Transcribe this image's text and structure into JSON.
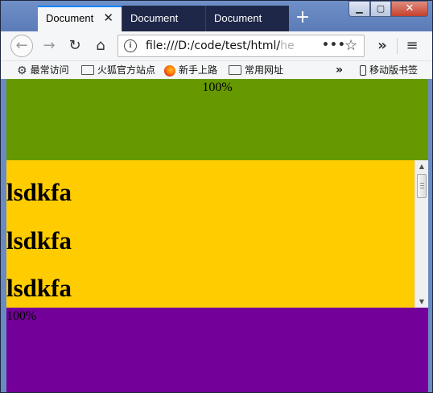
{
  "browser": {
    "tabs": [
      {
        "label": "Document",
        "active": true
      },
      {
        "label": "Document",
        "active": false
      },
      {
        "label": "Document",
        "active": false
      }
    ],
    "new_tab_label": "+",
    "close_tab_glyph": "✕",
    "window_controls": {
      "minimize_glyph": "▁",
      "maximize_glyph": "▢",
      "close_glyph": "✕"
    },
    "nav": {
      "back_glyph": "←",
      "forward_glyph": "→",
      "reload_glyph": "↻",
      "home_glyph": "⌂",
      "info_glyph": "i",
      "url_main": "file:///D:/code/test/html/",
      "url_faded": "he",
      "page_actions_glyph": "•••",
      "bookmark_star_glyph": "☆",
      "overflow_glyph": "»",
      "menu_glyph": "≡"
    },
    "bookmarks": [
      {
        "label": "最常访问",
        "icon": "gear-icon"
      },
      {
        "label": "火狐官方站点",
        "icon": "folder-icon"
      },
      {
        "label": "新手上路",
        "icon": "firefox-icon"
      },
      {
        "label": "常用网址",
        "icon": "folder-icon"
      }
    ],
    "bookmarks_overflow_glyph": "»",
    "mobile_bookmarks_label": "移动版书签"
  },
  "page": {
    "green_block": {
      "label": "100%",
      "color": "#669900"
    },
    "yellow_block": {
      "color": "#ffcc00",
      "headings": [
        "lsdkfa",
        "lsdkfa",
        "lsdkfa"
      ],
      "scroll_up_glyph": "▲",
      "scroll_down_glyph": "▼"
    },
    "purple_block": {
      "label": "100%",
      "color": "#730099"
    }
  },
  "colors": {
    "tab_accent": "#0a84ff",
    "titlebar": "#5b7cb8",
    "inactive_tab": "#1e2748",
    "toolbar": "#f5f6f7"
  }
}
